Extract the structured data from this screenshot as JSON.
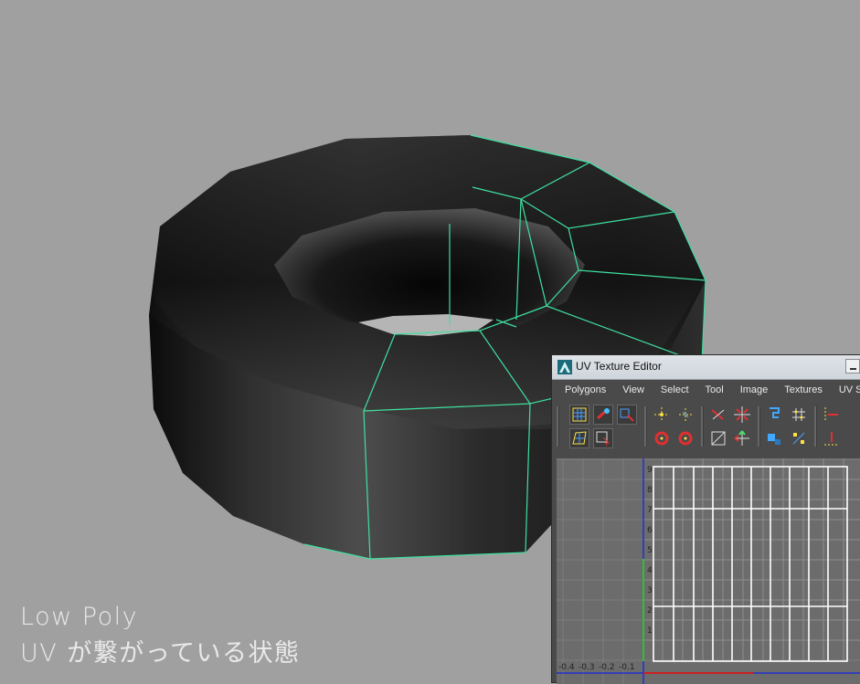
{
  "caption": {
    "line1": "Low Poly",
    "line2": "UV が繋がっている状態"
  },
  "uv_editor": {
    "title": "UV Texture Editor",
    "menu": [
      "Polygons",
      "View",
      "Select",
      "Tool",
      "Image",
      "Textures",
      "UV Sets"
    ],
    "axis": {
      "v_labels": [
        "9",
        "8",
        "7",
        "6",
        "5",
        "4",
        "3",
        "2",
        "1"
      ],
      "u_labels": [
        "-0.4",
        "-0.3",
        "-0.2",
        "-0.1"
      ]
    },
    "colors": {
      "wire": "#3fe0a0",
      "uv_shell": "#ffffff",
      "v_axis": "#2030d0",
      "u_axis_red": "#cc2020"
    }
  }
}
